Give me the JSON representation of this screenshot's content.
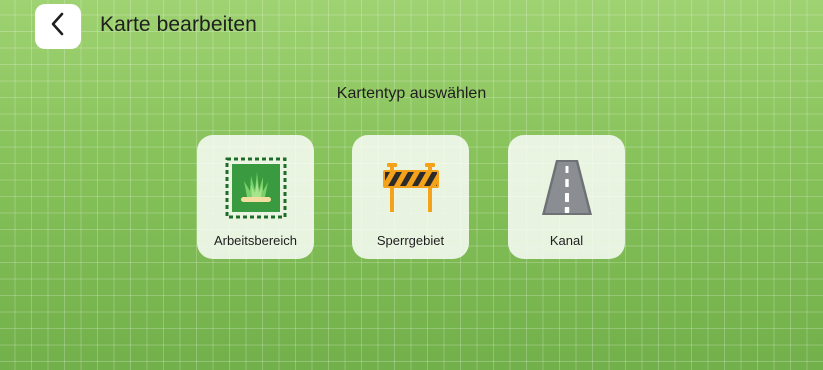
{
  "header": {
    "title": "Karte bearbeiten",
    "back_icon": "chevron-left-icon"
  },
  "main": {
    "subtitle": "Kartentyp auswählen",
    "cards": [
      {
        "label": "Arbeitsbereich",
        "icon": "grass-area-icon"
      },
      {
        "label": "Sperrgebiet",
        "icon": "road-barrier-icon"
      },
      {
        "label": "Kanal",
        "icon": "road-icon"
      }
    ]
  },
  "colors": {
    "background": "#86c159",
    "card": "#ffffff",
    "barrier_orange": "#f5a21b",
    "grass_green": "#3a9a3f"
  }
}
